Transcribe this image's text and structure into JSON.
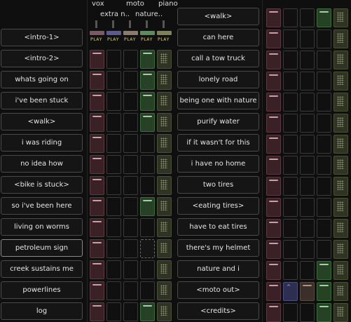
{
  "tracks": [
    {
      "name": "vox"
    },
    {
      "name": "extra n.."
    },
    {
      "name": "moto"
    },
    {
      "name": "nature.."
    },
    {
      "name": "piano"
    }
  ],
  "play_labels": [
    "PLAY",
    "PLAY",
    "PLAY",
    "PLAY",
    "PLAY"
  ],
  "left_scenes": [
    "<intro-1>",
    "<intro-2>",
    "whats going on",
    "i've been stuck",
    "<walk>",
    "i was riding",
    "no idea how",
    "<bike is stuck>",
    "so i've been here",
    "living on worms",
    "petroleum sign",
    "creek sustains me",
    "powerlines",
    "log"
  ],
  "right_scenes": [
    "<walk>",
    "can here",
    "call a tow truck",
    "lonely road",
    "being one with nature",
    "purify water",
    "if it wasn't for this",
    "i have no home",
    "two tires",
    "<eating tires>",
    "have to eat tires",
    "there's my helmet",
    "nature and i",
    "<moto out>",
    "<credits>"
  ],
  "colors": {
    "vox": "#7a5a64",
    "extra": "#5c5a8c",
    "moto": "#8a7a70",
    "nature": "#5f8a5f",
    "piano": "#80805a"
  },
  "left_grid": [
    [
      "red",
      "",
      "",
      "grn",
      "olv"
    ],
    [
      "red",
      "",
      "",
      "grn",
      "olv"
    ],
    [
      "red",
      "",
      "",
      "grn",
      "olv"
    ],
    [
      "red",
      "",
      "",
      "grn",
      "olv"
    ],
    [
      "red",
      "",
      "",
      "",
      "olv"
    ],
    [
      "red",
      "",
      "",
      "",
      "olv"
    ],
    [
      "red",
      "",
      "",
      "",
      "olv"
    ],
    [
      "red",
      "",
      "",
      "grn",
      "olv"
    ],
    [
      "red",
      "",
      "",
      "",
      "olv"
    ],
    [
      "red",
      "",
      "",
      "dash",
      "olv"
    ],
    [
      "red",
      "",
      "",
      "",
      "olv"
    ],
    [
      "red",
      "",
      "",
      "",
      "olv"
    ],
    [
      "red",
      "",
      "",
      "grn",
      "olv"
    ]
  ],
  "right_grid": [
    [
      "red",
      "",
      "",
      "grn",
      "olv"
    ],
    [
      "red",
      "",
      "",
      "",
      "olv"
    ],
    [
      "red",
      "",
      "",
      "",
      "olv"
    ],
    [
      "red",
      "",
      "",
      "",
      "olv"
    ],
    [
      "red",
      "",
      "",
      "",
      "olv"
    ],
    [
      "red",
      "",
      "",
      "",
      "olv"
    ],
    [
      "red",
      "",
      "",
      "",
      "olv"
    ],
    [
      "red",
      "",
      "",
      "",
      "olv"
    ],
    [
      "red",
      "",
      "",
      "",
      "olv"
    ],
    [
      "red",
      "",
      "",
      "",
      "olv"
    ],
    [
      "red",
      "",
      "",
      "",
      "olv"
    ],
    [
      "red",
      "",
      "",
      "",
      "olv"
    ],
    [
      "red",
      "",
      "",
      "grn",
      "olv"
    ],
    [
      "red",
      "blu",
      "tan",
      "grn",
      "olv"
    ],
    [
      "red",
      "",
      "",
      "grn",
      "olv"
    ]
  ]
}
